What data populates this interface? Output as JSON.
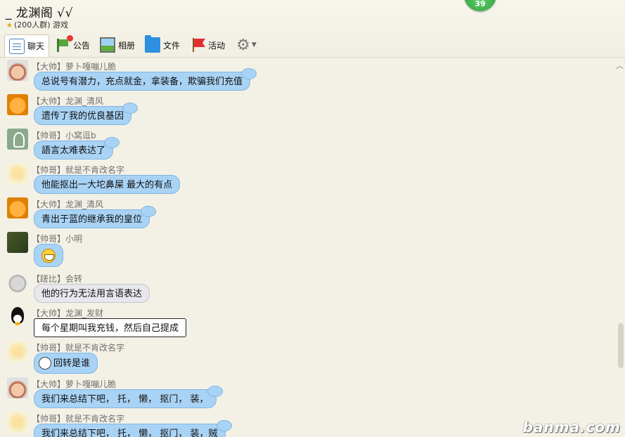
{
  "header": {
    "title": "_  龙渊阁  √√",
    "subtitle": "(200人群) 游戏",
    "badge": "39"
  },
  "toolbar": {
    "chat": "聊天",
    "notice": "公告",
    "album": "相册",
    "files": "文件",
    "events": "活动"
  },
  "messages": [
    {
      "name": "【大帅】萝卜嘎嘣儿脆",
      "text": "总说号有潜力，充点就金，拿装备，欺骗我们充值"
    },
    {
      "name": "【大帅】龙渊_清风",
      "text": "遗传了我的优良基因"
    },
    {
      "name": "【帅哥】小窝逗b",
      "text": "語言太难表达了"
    },
    {
      "name": "【帅哥】就是不肯改名字",
      "text": "他能抠出一大坨鼻屎     最大的有点"
    },
    {
      "name": "【大帅】龙渊_清风",
      "text": "青出于蓝的继承我的皇位"
    },
    {
      "name": "【帅哥】小明",
      "text": ""
    },
    {
      "name": "【蹉比】会转",
      "text": "他的行为无法用言语表达"
    },
    {
      "name": "【大帅】龙渊_发财",
      "text": "每个星期叫我充钱，然后自己提成"
    },
    {
      "name": "【帅哥】就是不肯改名字",
      "text": "回转是谁"
    },
    {
      "name": "【大帅】萝卜嘎嘣儿脆",
      "text": "我们来总结下吧，      托，   懒，   抠门，   装，"
    },
    {
      "name": "【帅哥】就是不肯改名字",
      "text": "我们来总结下吧，    托，    懒，    抠门，  装，贼"
    }
  ],
  "watermark": "banma.com",
  "colors": {
    "bubble_blue": "#a9d3f5",
    "bubble_grey": "#e7e7ec",
    "background": "#f3f1e6"
  }
}
